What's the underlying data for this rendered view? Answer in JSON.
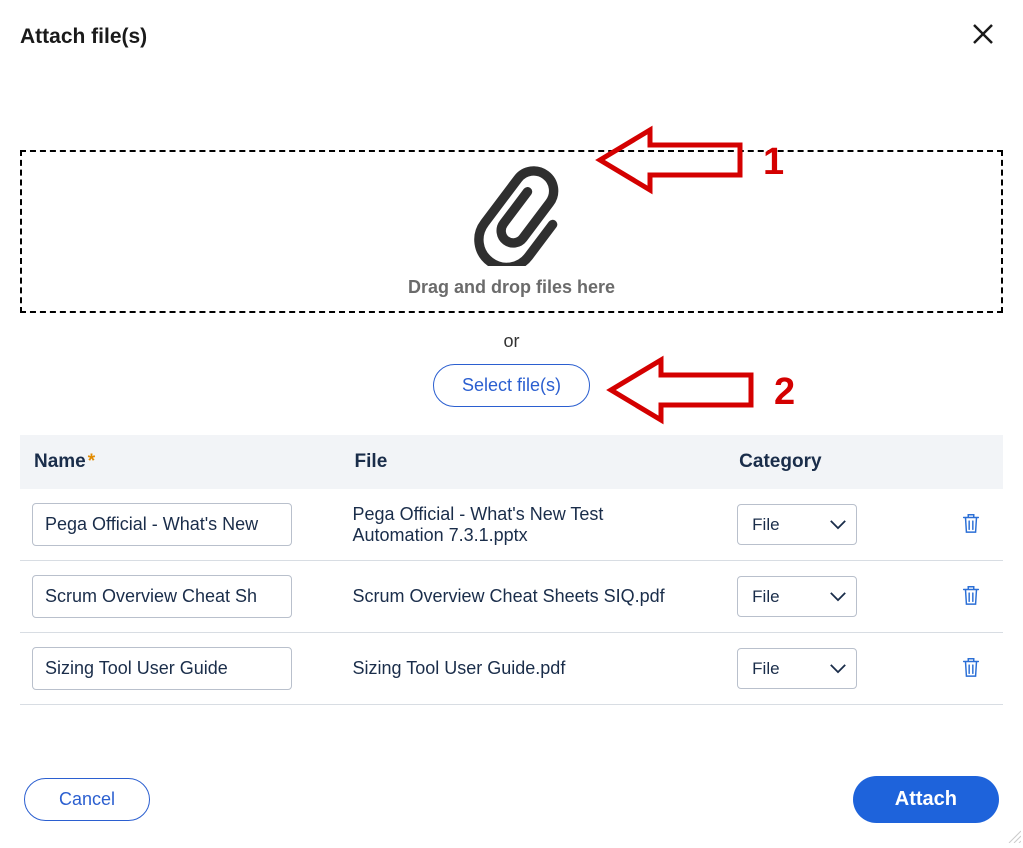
{
  "header": {
    "title": "Attach file(s)"
  },
  "dropzone": {
    "drop_text": "Drag and drop files here",
    "or_text": "or",
    "select_label": "Select file(s)"
  },
  "annotations": {
    "one": "1",
    "two": "2"
  },
  "table": {
    "headers": {
      "name": "Name",
      "required_mark": "*",
      "file": "File",
      "category": "Category"
    },
    "rows": [
      {
        "name_value": "Pega Official - What's New",
        "file_label": "Pega Official - What's New Test Automation 7.3.1.pptx",
        "category_value": "File"
      },
      {
        "name_value": "Scrum Overview Cheat Sh",
        "file_label": "Scrum Overview Cheat Sheets SIQ.pdf",
        "category_value": "File"
      },
      {
        "name_value": "Sizing Tool User Guide",
        "file_label": "Sizing Tool User Guide.pdf",
        "category_value": "File"
      }
    ],
    "category_options": [
      "File"
    ]
  },
  "footer": {
    "cancel_label": "Cancel",
    "attach_label": "Attach"
  }
}
